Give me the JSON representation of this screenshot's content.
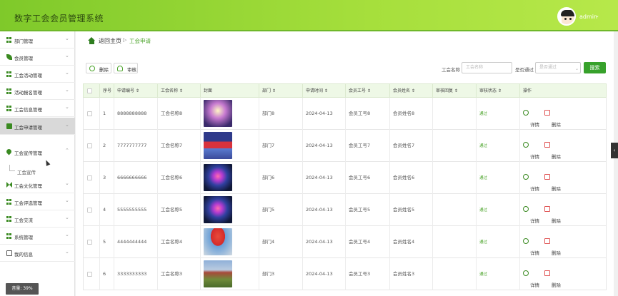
{
  "app": {
    "title": "数字工会会员管理系统",
    "user": "admin",
    "caret": "⌄"
  },
  "sidebar": {
    "items": [
      {
        "label": "部门管理",
        "icon": "grid-icon"
      },
      {
        "label": "会员管理",
        "icon": "leaf-icon"
      },
      {
        "label": "工会活动管理",
        "icon": "grid-icon"
      },
      {
        "label": "活动报名管理",
        "icon": "grid-icon"
      },
      {
        "label": "工会信息管理",
        "icon": "grid-icon"
      },
      {
        "label": "工会申请管理",
        "icon": "folder-icon"
      },
      {
        "label": "工会宣传管理",
        "icon": "pin-icon"
      },
      {
        "label": "工会文化管理",
        "icon": "bow-icon"
      },
      {
        "label": "工会评选管理",
        "icon": "grid-icon"
      },
      {
        "label": "工会交流",
        "icon": "grid-icon"
      },
      {
        "label": "系统管理",
        "icon": "grid-icon"
      },
      {
        "label": "我的信息",
        "icon": "id-card-icon"
      }
    ],
    "submenu_label": "工会宣传",
    "volume": "音量: 39%"
  },
  "breadcrumb": {
    "home": "返回主页",
    "separator": "▷",
    "current": "工会申请"
  },
  "toolbar": {
    "delete_label": "删除",
    "audit_label": "审核"
  },
  "filter": {
    "name_label": "工会名称",
    "name_placeholder": "工会名称",
    "passed_label": "是否通过",
    "passed_placeholder": "是否通过",
    "search_label": "搜索"
  },
  "table": {
    "headers": [
      "序号",
      "申请编号 ⇕",
      "工会名称 ⇕",
      "封面",
      "部门 ⇕",
      "申请时间 ⇕",
      "会员工号 ⇕",
      "会员姓名 ⇕",
      "审核回复 ⇕",
      "审核状态 ⇕",
      "操作"
    ],
    "rows": [
      {
        "idx": "1",
        "no": "8888888888",
        "name": "工会名称8",
        "dept": "部门8",
        "date": "2024-04-13",
        "member_no": "会员工号8",
        "member_name": "会员姓名8",
        "reply": "",
        "status": "通过",
        "cover": "stage"
      },
      {
        "idx": "2",
        "no": "7777777777",
        "name": "工会名称7",
        "dept": "部门7",
        "date": "2024-04-13",
        "member_no": "会员工号7",
        "member_name": "会员姓名7",
        "reply": "",
        "status": "通过",
        "cover": "banner"
      },
      {
        "idx": "3",
        "no": "6666666666",
        "name": "工会名称6",
        "dept": "部门6",
        "date": "2024-04-13",
        "member_no": "会员工号6",
        "member_name": "会员姓名6",
        "reply": "",
        "status": "通过",
        "cover": "tree"
      },
      {
        "idx": "4",
        "no": "5555555555",
        "name": "工会名称5",
        "dept": "部门5",
        "date": "2024-04-13",
        "member_no": "会员工号5",
        "member_name": "会员姓名5",
        "reply": "",
        "status": "通过",
        "cover": "tree"
      },
      {
        "idx": "5",
        "no": "4444444444",
        "name": "工会名称4",
        "dept": "部门4",
        "date": "2024-04-13",
        "member_no": "会员工号4",
        "member_name": "会员姓名4",
        "reply": "",
        "status": "通过",
        "cover": "arch"
      },
      {
        "idx": "6",
        "no": "3333333333",
        "name": "工会名称3",
        "dept": "部门3",
        "date": "2024-04-13",
        "member_no": "会员工号3",
        "member_name": "会员姓名3",
        "reply": "",
        "status": "通过",
        "cover": "field"
      }
    ],
    "actions": {
      "detail": "详情",
      "delete": "删除"
    }
  },
  "colors": {
    "brand": "#8fd332",
    "accent": "#37a12b",
    "status_pass": "#4aa329"
  }
}
